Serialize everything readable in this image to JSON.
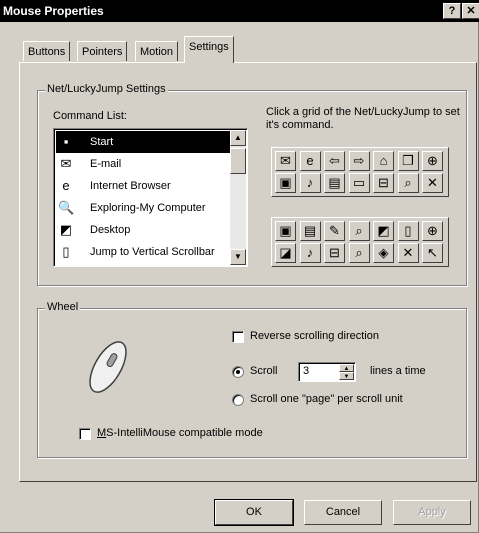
{
  "window": {
    "title": "Mouse Properties",
    "help_btn": "?",
    "close_btn": "✕"
  },
  "tabs": [
    "Buttons",
    "Pointers",
    "Motion",
    "Settings"
  ],
  "active_tab": "Settings",
  "net_group": {
    "legend": "Net/LuckyJump Settings",
    "command_list_label": "Command List:",
    "hint": "Click a grid of the Net/LuckyJump to set it's command.",
    "commands": [
      {
        "label": "Start",
        "icon": "start-icon",
        "glyph": "▪",
        "selected": true
      },
      {
        "label": "E-mail",
        "icon": "email-icon",
        "glyph": "✉",
        "selected": false
      },
      {
        "label": "Internet Browser",
        "icon": "internet-explorer-icon",
        "glyph": "e",
        "selected": false
      },
      {
        "label": "Exploring-My Computer",
        "icon": "explorer-icon",
        "glyph": "🔍",
        "selected": false
      },
      {
        "label": "Desktop",
        "icon": "desktop-icon",
        "glyph": "◩",
        "selected": false
      },
      {
        "label": "Jump to Vertical Scrollbar",
        "icon": "vertical-scrollbar-icon",
        "glyph": "▯",
        "selected": false
      }
    ],
    "grid1": [
      [
        {
          "icon": "email-icon",
          "glyph": "✉"
        },
        {
          "icon": "internet-explorer-icon",
          "glyph": "e"
        },
        {
          "icon": "back-arrow-icon",
          "glyph": "⇦"
        },
        {
          "icon": "forward-arrow-icon",
          "glyph": "⇨"
        },
        {
          "icon": "home-folder-icon",
          "glyph": "⌂"
        },
        {
          "icon": "copy-icon",
          "glyph": "❐"
        },
        {
          "icon": "crosshair-icon",
          "glyph": "⊕"
        }
      ],
      [
        {
          "icon": "window-icon",
          "glyph": "▣"
        },
        {
          "icon": "speaker-icon",
          "glyph": "♪"
        },
        {
          "icon": "document-icon",
          "glyph": "▤"
        },
        {
          "icon": "screen-icon",
          "glyph": "▭"
        },
        {
          "icon": "minimize-window-icon",
          "glyph": "⊟"
        },
        {
          "icon": "search-doc-icon",
          "glyph": "⌕"
        },
        {
          "icon": "close-x-icon",
          "glyph": "✕"
        }
      ]
    ],
    "grid2": [
      [
        {
          "icon": "window-icon",
          "glyph": "▣"
        },
        {
          "icon": "document-icon",
          "glyph": "▤"
        },
        {
          "icon": "edit-icon",
          "glyph": "✎"
        },
        {
          "icon": "explorer-icon",
          "glyph": "⌕"
        },
        {
          "icon": "desktop-icon",
          "glyph": "◩"
        },
        {
          "icon": "vertical-scrollbar-icon",
          "glyph": "▯"
        },
        {
          "icon": "crosshair-icon",
          "glyph": "⊕"
        }
      ],
      [
        {
          "icon": "drive-icon",
          "glyph": "◪"
        },
        {
          "icon": "speaker-icon",
          "glyph": "♪"
        },
        {
          "icon": "minimize-window-icon",
          "glyph": "⊟"
        },
        {
          "icon": "search-doc-icon",
          "glyph": "⌕"
        },
        {
          "icon": "disk-icon",
          "glyph": "◈"
        },
        {
          "icon": "close-x-icon",
          "glyph": "✕"
        },
        {
          "icon": "resize-arrow-icon",
          "glyph": "↖"
        }
      ]
    ]
  },
  "wheel_group": {
    "legend": "Wheel",
    "reverse_label": "Reverse scrolling direction",
    "reverse_checked": false,
    "scroll_label": "Scroll",
    "scroll_lines": "3",
    "lines_label": "lines a time",
    "scroll_selected": true,
    "page_label": "Scroll one \"page\" per scroll unit",
    "page_selected": false,
    "intellimouse_prefix": "M",
    "intellimouse_label": "S-IntelliMouse compatible mode",
    "intellimouse_checked": false
  },
  "buttons": {
    "ok": "OK",
    "cancel": "Cancel",
    "apply": "Apply"
  }
}
